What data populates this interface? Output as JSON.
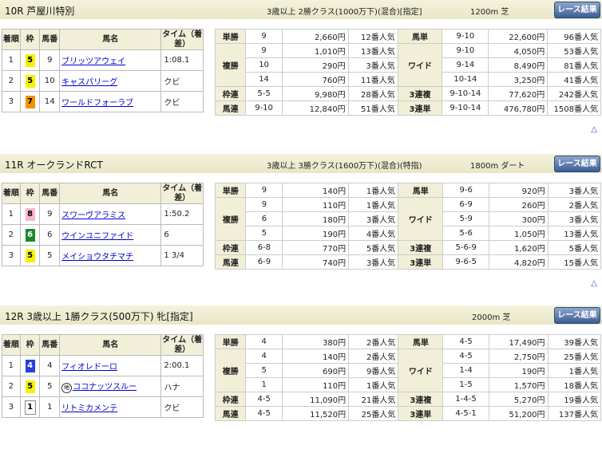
{
  "headers": {
    "finish": "着順",
    "waku": "枠",
    "num": "馬番",
    "name": "馬名",
    "time": "タイム（着差）",
    "button": "レース結果",
    "up": "△"
  },
  "races": [
    {
      "title": "10R 芦屋川特別",
      "cond": "3歳以上 2勝クラス(1000万下)(混合)[指定]",
      "dist": "1200m 芝",
      "horses": [
        {
          "pos": "1",
          "waku": "5",
          "wc": "#f7f000",
          "wf": "#000",
          "num": "9",
          "name": "ブリッツアウェイ",
          "time": "1:08.1"
        },
        {
          "pos": "2",
          "waku": "5",
          "wc": "#f7f000",
          "wf": "#000",
          "num": "10",
          "name": "キャスパリーグ",
          "time": "クビ"
        },
        {
          "pos": "3",
          "waku": "7",
          "wc": "#f29300",
          "wf": "#000",
          "num": "14",
          "name": "ワールドフォーラブ",
          "time": "クビ"
        }
      ],
      "pay": [
        {
          "k": "単勝",
          "rows": [
            [
              "9",
              "2,660円",
              "12番人気"
            ]
          ],
          "k2": "馬単",
          "rows2": [
            [
              "9-10",
              "22,600円",
              "96番人気"
            ]
          ]
        },
        {
          "k": "複勝",
          "rows": [
            [
              "9",
              "1,010円",
              "13番人気"
            ],
            [
              "10",
              "290円",
              "3番人気"
            ],
            [
              "14",
              "760円",
              "11番人気"
            ]
          ],
          "k2": "ワイド",
          "rows2": [
            [
              "9-10",
              "4,050円",
              "53番人気"
            ],
            [
              "9-14",
              "8,490円",
              "81番人気"
            ],
            [
              "10-14",
              "3,250円",
              "41番人気"
            ]
          ]
        },
        {
          "k": "枠連",
          "rows": [
            [
              "5-5",
              "9,980円",
              "28番人気"
            ]
          ],
          "k2": "3連複",
          "rows2": [
            [
              "9-10-14",
              "77,620円",
              "242番人気"
            ]
          ]
        },
        {
          "k": "馬連",
          "rows": [
            [
              "9-10",
              "12,840円",
              "51番人気"
            ]
          ],
          "k2": "3連単",
          "rows2": [
            [
              "9-10-14",
              "476,780円",
              "1508番人気"
            ]
          ]
        }
      ]
    },
    {
      "title": "11R オークランドRCT",
      "cond": "3歳以上 3勝クラス(1600万下)(混合)(特指)",
      "dist": "1800m ダート",
      "horses": [
        {
          "pos": "1",
          "waku": "8",
          "wc": "#f8b8c8",
          "wf": "#000",
          "num": "9",
          "name": "スワーヴアラミス",
          "time": "1:50.2"
        },
        {
          "pos": "2",
          "waku": "6",
          "wc": "#1a8a2a",
          "wf": "#fff",
          "num": "6",
          "name": "ウインユニファイド",
          "time": "6"
        },
        {
          "pos": "3",
          "waku": "5",
          "wc": "#f7f000",
          "wf": "#000",
          "num": "5",
          "name": "メイショウタチマチ",
          "time": "1 3/4"
        }
      ],
      "pay": [
        {
          "k": "単勝",
          "rows": [
            [
              "9",
              "140円",
              "1番人気"
            ]
          ],
          "k2": "馬単",
          "rows2": [
            [
              "9-6",
              "920円",
              "3番人気"
            ]
          ]
        },
        {
          "k": "複勝",
          "rows": [
            [
              "9",
              "110円",
              "1番人気"
            ],
            [
              "6",
              "180円",
              "3番人気"
            ],
            [
              "5",
              "190円",
              "4番人気"
            ]
          ],
          "k2": "ワイド",
          "rows2": [
            [
              "6-9",
              "260円",
              "2番人気"
            ],
            [
              "5-9",
              "300円",
              "3番人気"
            ],
            [
              "5-6",
              "1,050円",
              "13番人気"
            ]
          ]
        },
        {
          "k": "枠連",
          "rows": [
            [
              "6-8",
              "770円",
              "5番人気"
            ]
          ],
          "k2": "3連複",
          "rows2": [
            [
              "5-6-9",
              "1,620円",
              "5番人気"
            ]
          ]
        },
        {
          "k": "馬連",
          "rows": [
            [
              "6-9",
              "740円",
              "3番人気"
            ]
          ],
          "k2": "3連単",
          "rows2": [
            [
              "9-6-5",
              "4,820円",
              "15番人気"
            ]
          ]
        }
      ]
    },
    {
      "title": "12R 3歳以上 1勝クラス(500万下) 牝[指定]",
      "cond": "",
      "dist": "2000m 芝",
      "horses": [
        {
          "pos": "1",
          "waku": "4",
          "wc": "#2a40d8",
          "wf": "#fff",
          "num": "4",
          "name": "フィオレドーロ",
          "time": "2:00.1",
          "mark": ""
        },
        {
          "pos": "2",
          "waku": "5",
          "wc": "#f7f000",
          "wf": "#000",
          "num": "5",
          "name": "ココナッツスルー",
          "time": "ハナ",
          "mark": "地"
        },
        {
          "pos": "3",
          "waku": "1",
          "wc": "#ffffff",
          "wf": "#000",
          "num": "1",
          "name": "リトミカメンテ",
          "time": "クビ",
          "mark": ""
        }
      ],
      "pay": [
        {
          "k": "単勝",
          "rows": [
            [
              "4",
              "380円",
              "2番人気"
            ]
          ],
          "k2": "馬単",
          "rows2": [
            [
              "4-5",
              "17,490円",
              "39番人気"
            ]
          ]
        },
        {
          "k": "複勝",
          "rows": [
            [
              "4",
              "140円",
              "2番人気"
            ],
            [
              "5",
              "690円",
              "9番人気"
            ],
            [
              "1",
              "110円",
              "1番人気"
            ]
          ],
          "k2": "ワイド",
          "rows2": [
            [
              "4-5",
              "2,750円",
              "25番人気"
            ],
            [
              "1-4",
              "190円",
              "1番人気"
            ],
            [
              "1-5",
              "1,570円",
              "18番人気"
            ]
          ]
        },
        {
          "k": "枠連",
          "rows": [
            [
              "4-5",
              "11,090円",
              "21番人気"
            ]
          ],
          "k2": "3連複",
          "rows2": [
            [
              "1-4-5",
              "5,270円",
              "19番人気"
            ]
          ]
        },
        {
          "k": "馬連",
          "rows": [
            [
              "4-5",
              "11,520円",
              "25番人気"
            ]
          ],
          "k2": "3連単",
          "rows2": [
            [
              "4-5-1",
              "51,200円",
              "137番人気"
            ]
          ]
        }
      ]
    }
  ]
}
